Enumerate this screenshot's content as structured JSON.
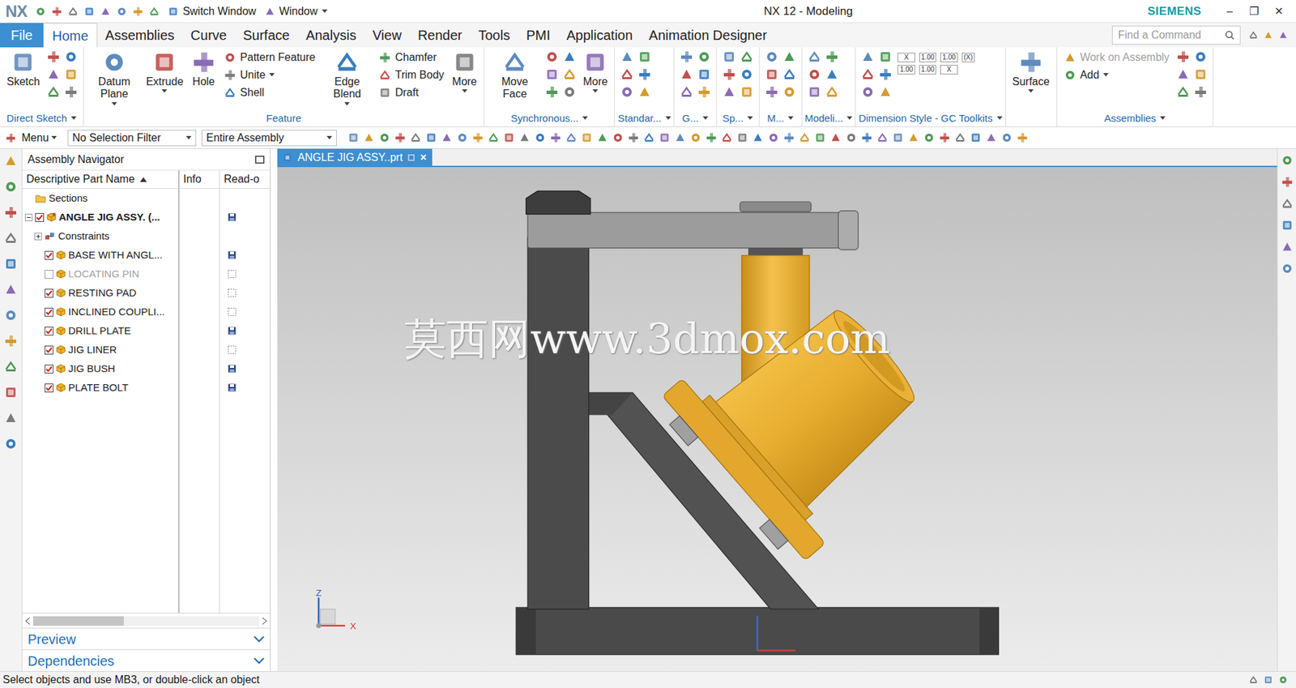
{
  "window": {
    "logo": "NX",
    "quick_access": [
      {
        "label": "Switch Window",
        "dropdown": false
      },
      {
        "label": "Window",
        "dropdown": true
      }
    ],
    "title": "NX 12 - Modeling",
    "brand": "SIEMENS",
    "controls": [
      "–",
      "❐",
      "✕"
    ]
  },
  "tabs": [
    {
      "label": "File",
      "selected": false,
      "kind": "file"
    },
    {
      "label": "Home",
      "selected": true,
      "kind": "tab"
    },
    {
      "label": "Assemblies",
      "selected": false,
      "kind": "tab"
    },
    {
      "label": "Curve",
      "selected": false,
      "kind": "tab"
    },
    {
      "label": "Surface",
      "selected": false,
      "kind": "tab"
    },
    {
      "label": "Analysis",
      "selected": false,
      "kind": "tab"
    },
    {
      "label": "View",
      "selected": false,
      "kind": "tab"
    },
    {
      "label": "Render",
      "selected": false,
      "kind": "tab"
    },
    {
      "label": "Tools",
      "selected": false,
      "kind": "tab"
    },
    {
      "label": "PMI",
      "selected": false,
      "kind": "tab"
    },
    {
      "label": "Application",
      "selected": false,
      "kind": "tab"
    },
    {
      "label": "Animation Designer",
      "selected": false,
      "kind": "tab"
    }
  ],
  "search": {
    "placeholder": "Find a Command"
  },
  "ribbon": {
    "groups": [
      {
        "title": "Direct Sketch",
        "dropdown": true,
        "items": [
          {
            "kind": "large",
            "label": "Sketch",
            "dropdown": false
          },
          {
            "kind": "icons"
          }
        ]
      },
      {
        "title": "Feature",
        "dropdown": false,
        "items": [
          {
            "kind": "large",
            "label": "Datum Plane",
            "dropdown": true
          },
          {
            "kind": "large",
            "label": "Extrude",
            "dropdown": true
          },
          {
            "kind": "large",
            "label": "Hole",
            "dropdown": false
          },
          {
            "kind": "stack",
            "entries": [
              {
                "label": "Pattern Feature",
                "dropdown": false,
                "disabled": false
              },
              {
                "label": "Unite",
                "dropdown": true,
                "disabled": false
              },
              {
                "label": "Shell",
                "dropdown": false,
                "disabled": false
              }
            ]
          },
          {
            "kind": "large",
            "label": "Edge Blend",
            "dropdown": true
          },
          {
            "kind": "stack",
            "entries": [
              {
                "label": "Chamfer",
                "dropdown": false,
                "disabled": false
              },
              {
                "label": "Trim Body",
                "dropdown": false,
                "disabled": false
              },
              {
                "label": "Draft",
                "dropdown": false,
                "disabled": false
              }
            ]
          },
          {
            "kind": "large",
            "label": "More",
            "dropdown": true
          }
        ]
      },
      {
        "title": "Synchronous...",
        "dropdown": true,
        "items": [
          {
            "kind": "large",
            "label": "Move Face",
            "dropdown": false
          },
          {
            "kind": "icons"
          },
          {
            "kind": "large",
            "label": "More",
            "dropdown": true
          }
        ]
      },
      {
        "title": "Standar...",
        "dropdown": true,
        "items": [
          {
            "kind": "icons"
          }
        ]
      },
      {
        "title": "G...",
        "dropdown": true,
        "items": [
          {
            "kind": "icons"
          }
        ]
      },
      {
        "title": "Sp...",
        "dropdown": true,
        "items": [
          {
            "kind": "icons"
          }
        ]
      },
      {
        "title": "M...",
        "dropdown": true,
        "items": [
          {
            "kind": "icons"
          }
        ]
      },
      {
        "title": "Modeli...",
        "dropdown": true,
        "items": [
          {
            "kind": "icons"
          }
        ]
      },
      {
        "title": "Dimension Style - GC Toolkits",
        "dropdown": true,
        "items": [
          {
            "kind": "icons"
          },
          {
            "kind": "labels",
            "texts": [
              "X",
              "1.00",
              "1.00",
              "1.00",
              "1.00",
              "X",
              "(X)"
            ]
          }
        ]
      },
      {
        "title": "",
        "dropdown": false,
        "items": [
          {
            "kind": "large",
            "label": "Surface",
            "dropdown": true
          }
        ]
      },
      {
        "title": "Assemblies",
        "dropdown": true,
        "items": [
          {
            "kind": "stack",
            "entries": [
              {
                "label": "Work on Assembly",
                "dropdown": false,
                "disabled": true
              },
              {
                "label": "Add",
                "dropdown": true,
                "disabled": false
              }
            ]
          },
          {
            "kind": "icons"
          }
        ]
      }
    ]
  },
  "toolbar": {
    "menu": {
      "label": "Menu",
      "dropdown": true
    },
    "selection_filter": "No Selection Filter",
    "scope": "Entire Assembly"
  },
  "navigator": {
    "title": "Assembly Navigator",
    "columns": [
      {
        "label": "Descriptive Part Name",
        "sorted": true
      },
      {
        "label": "Info",
        "sorted": false
      },
      {
        "label": "Read-o",
        "sorted": false
      }
    ],
    "rows": [
      {
        "label": "Sections",
        "kind": "folder",
        "depth": 0
      },
      {
        "label": "ANGLE JIG ASSY. (...",
        "kind": "assembly",
        "depth": 0,
        "expanded": true,
        "checked": true,
        "bold": true,
        "dim": false,
        "saved": true
      },
      {
        "label": "Constraints",
        "kind": "constraints",
        "depth": 1,
        "expanded": false
      },
      {
        "label": "BASE WITH ANGL...",
        "kind": "part",
        "depth": 1,
        "checked": true,
        "bold": false,
        "dim": false,
        "saved": true
      },
      {
        "label": "LOCATING PIN",
        "kind": "part",
        "depth": 1,
        "checked": false,
        "bold": false,
        "dim": true,
        "saved": false
      },
      {
        "label": "RESTING PAD",
        "kind": "part",
        "depth": 1,
        "checked": true,
        "bold": false,
        "dim": false,
        "saved": false
      },
      {
        "label": "INCLINED COUPLI...",
        "kind": "part",
        "depth": 1,
        "checked": true,
        "bold": false,
        "dim": false,
        "saved": false
      },
      {
        "label": "DRILL PLATE",
        "kind": "part",
        "depth": 1,
        "checked": true,
        "bold": false,
        "dim": false,
        "saved": true
      },
      {
        "label": "JIG LINER",
        "kind": "part",
        "depth": 1,
        "checked": true,
        "bold": false,
        "dim": false,
        "saved": false
      },
      {
        "label": "JIG BUSH",
        "kind": "part",
        "depth": 1,
        "checked": true,
        "bold": false,
        "dim": false,
        "saved": true
      },
      {
        "label": "PLATE BOLT",
        "kind": "part",
        "depth": 1,
        "checked": true,
        "bold": false,
        "dim": false,
        "saved": true
      }
    ],
    "panels": [
      {
        "label": "Preview",
        "expanded": false
      },
      {
        "label": "Dependencies",
        "expanded": false
      }
    ]
  },
  "graphics": {
    "tab": {
      "label": "ANGLE JIG ASSY..prt",
      "close": "×",
      "selected": true
    },
    "watermark": "莫西网www.3dmox.com",
    "axes": {
      "z": "Z",
      "x": "X"
    }
  },
  "status_bar": {
    "message": "Select objects and use MB3, or double-click an object"
  }
}
